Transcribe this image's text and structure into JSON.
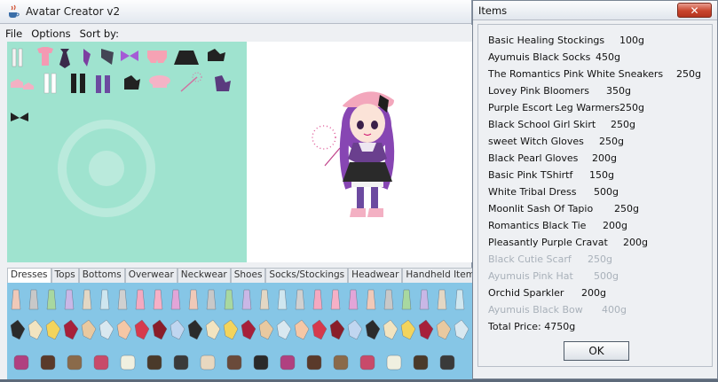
{
  "main_window": {
    "title": "Avatar Creator v2",
    "menu": [
      "File",
      "Options",
      "Sort by:"
    ],
    "tabs": [
      "Dresses",
      "Tops",
      "Bottoms",
      "Overwear",
      "Neckwear",
      "Shoes",
      "Socks/Stockings",
      "Headwear",
      "Handheld Items"
    ],
    "active_tab": "Dresses"
  },
  "dialog": {
    "title": "Items",
    "close_icon": "close-icon",
    "items": [
      {
        "name": "Basic Healing Stockings",
        "price": "100g",
        "faded": false
      },
      {
        "name": "Ayumuis Black Socks",
        "price": "450g",
        "faded": false
      },
      {
        "name": "The Romantics Pink White Sneakers",
        "price": "250g",
        "faded": false
      },
      {
        "name": "Lovey Pink Bloomers",
        "price": "350g",
        "faded": false
      },
      {
        "name": "Purple Escort Leg Warmers",
        "price": "250g",
        "faded": false
      },
      {
        "name": "Black School Girl Skirt",
        "price": "250g",
        "faded": false
      },
      {
        "name": "sweet Witch Gloves",
        "price": "250g",
        "faded": false
      },
      {
        "name": "Black Pearl Gloves",
        "price": "200g",
        "faded": false
      },
      {
        "name": "Basic Pink TShirtf",
        "price": "150g",
        "faded": false
      },
      {
        "name": "White Tribal Dress",
        "price": "500g",
        "faded": false
      },
      {
        "name": "Moonlit Sash Of Tapio",
        "price": "250g",
        "faded": false
      },
      {
        "name": "Romantics Black Tie",
        "price": "200g",
        "faded": false
      },
      {
        "name": "Pleasantly Purple Cravat",
        "price": "200g",
        "faded": false
      },
      {
        "name": "Black Cutie Scarf",
        "price": "250g",
        "faded": true
      },
      {
        "name": "Ayumuis Pink Hat",
        "price": "500g",
        "faded": true
      },
      {
        "name": "Orchid Sparkler",
        "price": "200g",
        "faded": false
      },
      {
        "name": "Ayumuis Black Bow",
        "price": "400g",
        "faded": true
      }
    ],
    "total_label": "Total Price: 4750g",
    "ok_label": "OK"
  },
  "colors": {
    "closet_bg": "#9fe3cf",
    "shelf_bg": "#86c6e6",
    "close_button": "#c8442c"
  }
}
